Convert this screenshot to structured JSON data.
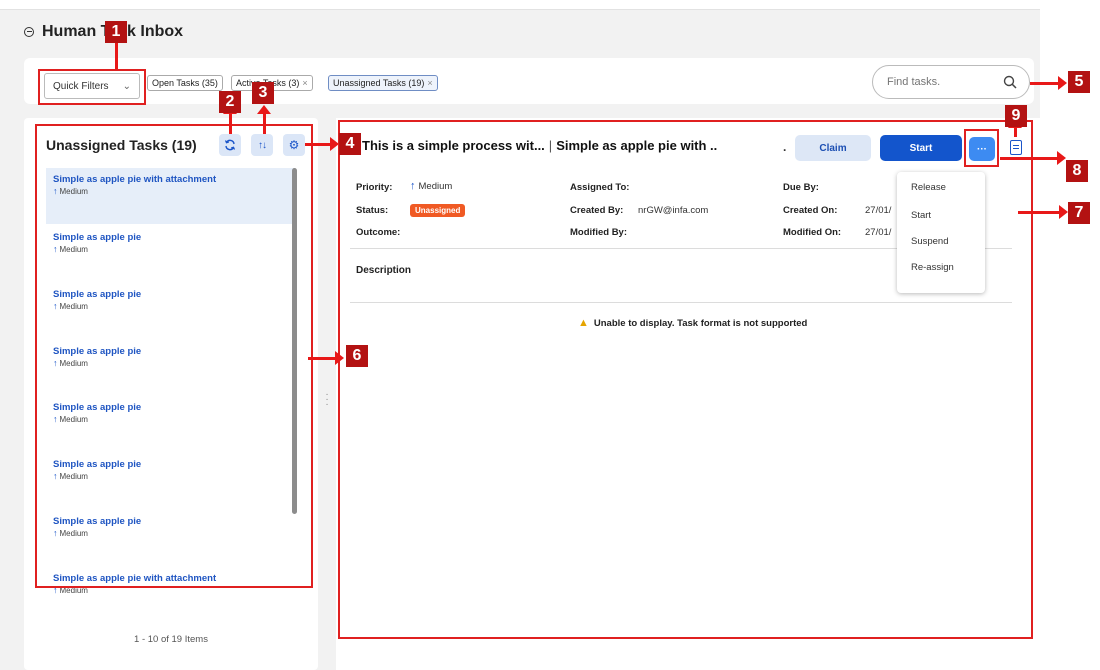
{
  "page": {
    "title": "Human Task Inbox"
  },
  "filters": {
    "quick_filters_label": "Quick Filters",
    "chips": [
      {
        "label": "Open Tasks (35)",
        "closable": false
      },
      {
        "label": "Active Tasks (3)",
        "closable": true
      },
      {
        "label": "Unassigned Tasks (19)",
        "closable": true
      }
    ]
  },
  "search": {
    "placeholder": "Find tasks."
  },
  "task_list": {
    "title": "Unassigned Tasks (19)",
    "items": [
      {
        "name": "Simple as apple pie with attachment",
        "priority": "Medium"
      },
      {
        "name": "Simple as apple pie",
        "priority": "Medium"
      },
      {
        "name": "Simple as apple pie",
        "priority": "Medium"
      },
      {
        "name": "Simple as apple pie",
        "priority": "Medium"
      },
      {
        "name": "Simple as apple pie",
        "priority": "Medium"
      },
      {
        "name": "Simple as apple pie",
        "priority": "Medium"
      },
      {
        "name": "Simple as apple pie",
        "priority": "Medium"
      },
      {
        "name": "Simple as apple pie with attachment",
        "priority": "Medium"
      }
    ],
    "pagination": "1 - 10 of 19 Items"
  },
  "detail": {
    "title_process": "This is a simple process wit...",
    "title_task": "Simple as apple pie with ..",
    "dot": ".",
    "claim_label": "Claim",
    "start_label": "Start",
    "more_label": "···",
    "fields": {
      "priority_label": "Priority:",
      "priority_value": "Medium",
      "status_label": "Status:",
      "status_value": "Unassigned",
      "outcome_label": "Outcome:",
      "assigned_to_label": "Assigned To:",
      "created_by_label": "Created By:",
      "created_by_value": "nrGW@infa.com",
      "modified_by_label": "Modified By:",
      "due_by_label": "Due By:",
      "created_on_label": "Created On:",
      "created_on_value": "27/01/",
      "modified_on_label": "Modified On:",
      "modified_on_value": "27/01/"
    },
    "description_label": "Description",
    "warning_text": "Unable to display. Task format is not supported"
  },
  "actions_menu": {
    "items": [
      "Release",
      "Start",
      "Suspend",
      "Re-assign"
    ]
  },
  "callouts": [
    "1",
    "2",
    "3",
    "4",
    "5",
    "6",
    "7",
    "8",
    "9"
  ],
  "colors": {
    "primary": "#1355cc",
    "accent": "#3d8bf2",
    "status_unassigned": "#f05a24",
    "callout": "#b31212",
    "annotation": "#e02020"
  }
}
